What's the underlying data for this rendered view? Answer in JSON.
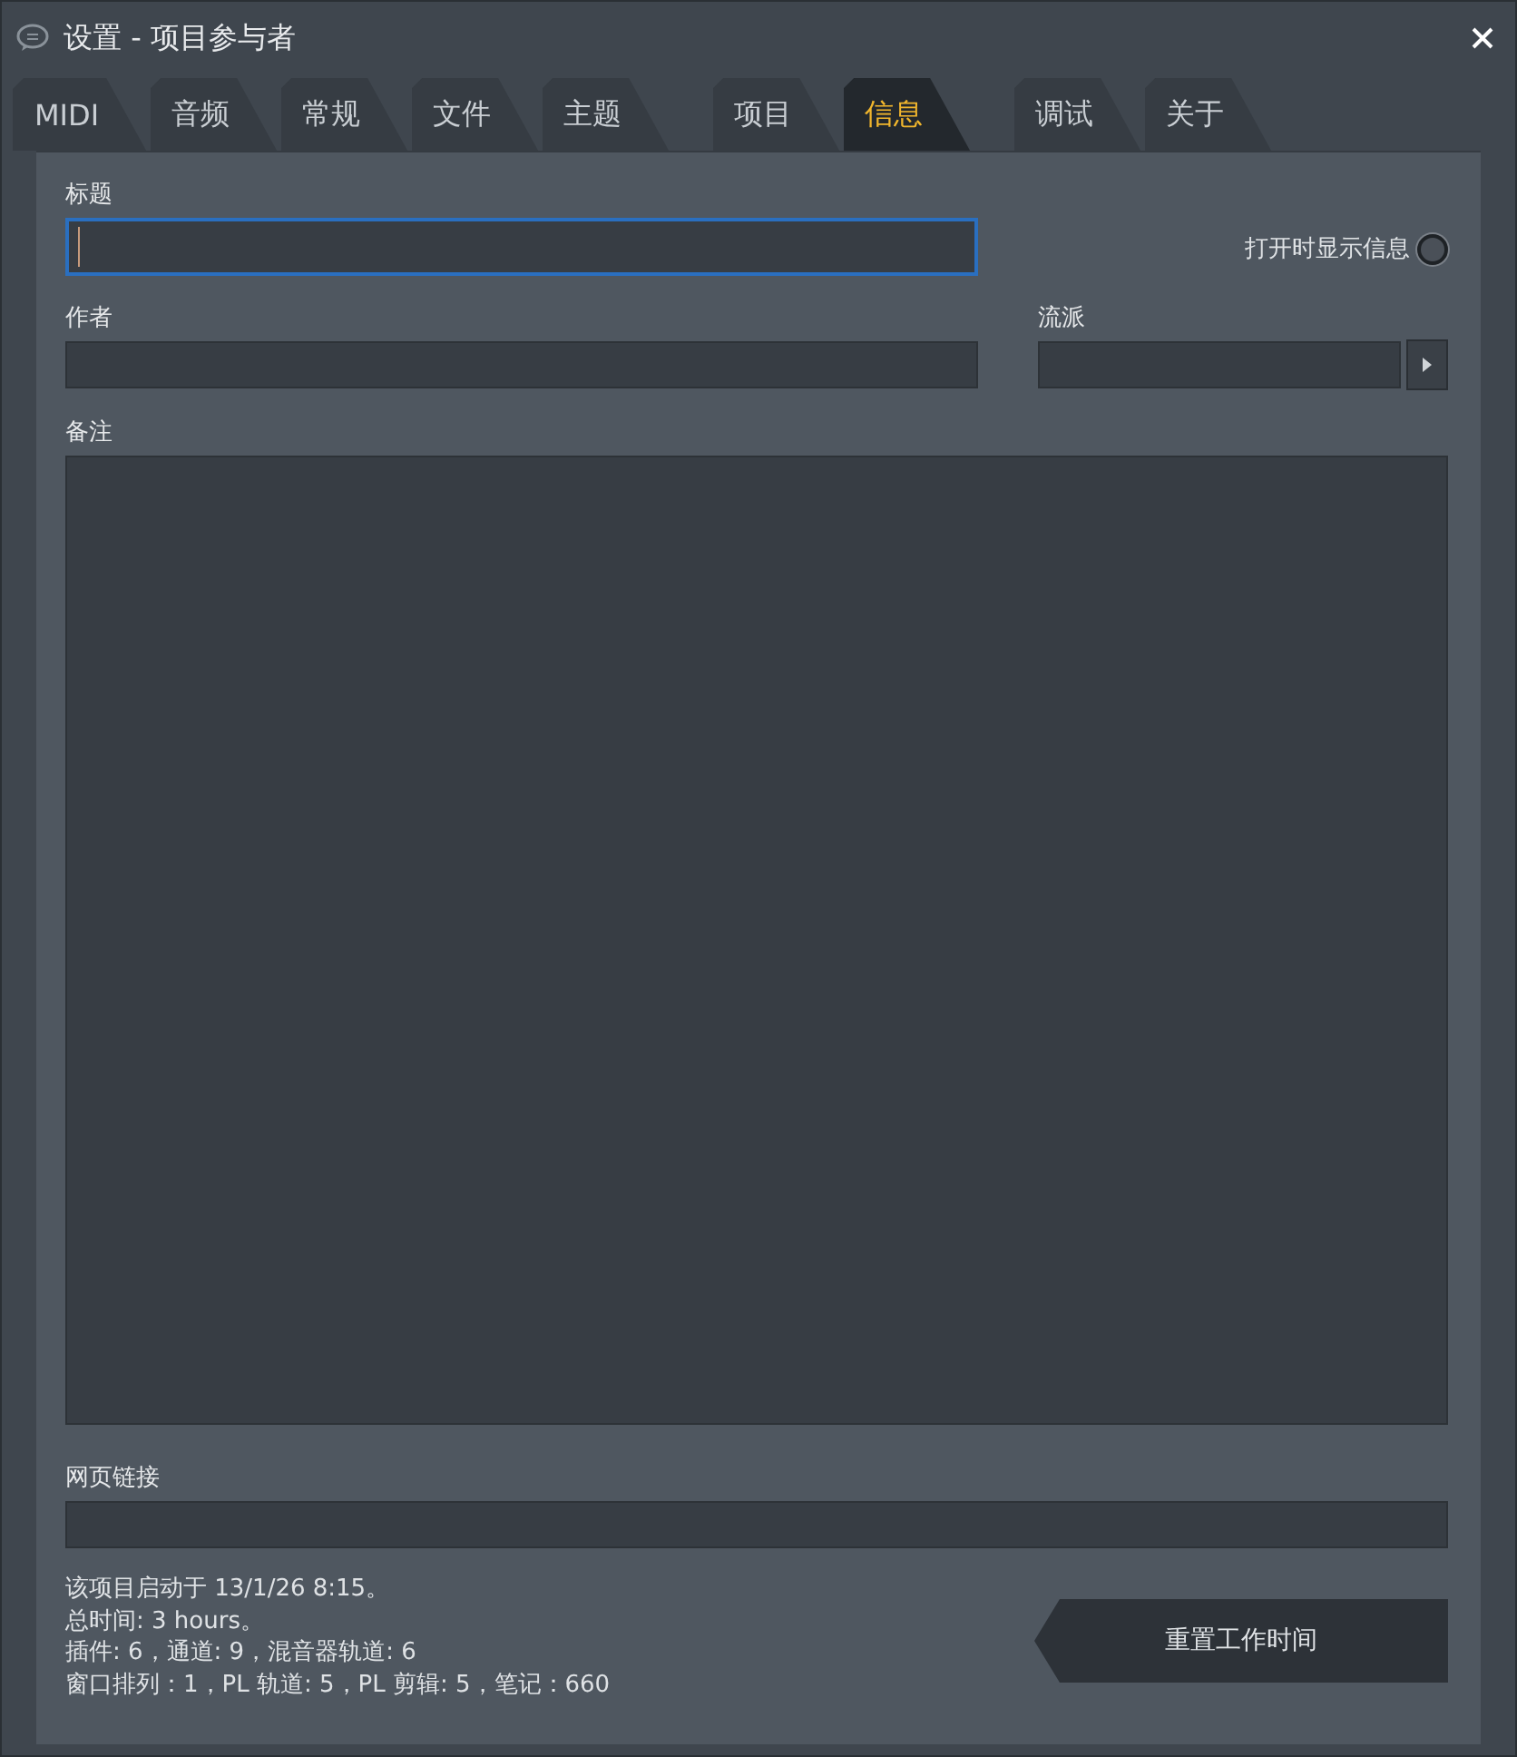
{
  "window": {
    "title": "设置 - 项目参与者"
  },
  "tab_groups": [
    [
      {
        "label": "MIDI",
        "selected": false
      },
      {
        "label": "音频",
        "selected": false
      },
      {
        "label": "常规",
        "selected": false
      },
      {
        "label": "文件",
        "selected": false
      },
      {
        "label": "主题",
        "selected": false
      }
    ],
    [
      {
        "label": "项目",
        "selected": false
      },
      {
        "label": "信息",
        "selected": true
      }
    ],
    [
      {
        "label": "调试",
        "selected": false
      },
      {
        "label": "关于",
        "selected": false
      }
    ]
  ],
  "title_field": {
    "label": "标题",
    "focused": true
  },
  "show_on_open": {
    "label": "打开时显示信息",
    "checked": false
  },
  "author_field": {
    "label": "作者"
  },
  "genre_field": {
    "label": "流派"
  },
  "notes_field": {
    "label": "备注"
  },
  "url_field": {
    "label": "网页链接"
  },
  "info_lines": [
    "该项目启动于 13/1/26 8:15。",
    "总时间:  3 hours。",
    "插件: 6，通道: 9，混音器轨道: 6",
    "窗口排列：1，PL 轨道: 5，PL 剪辑: 5，笔记：660"
  ],
  "reset_button": "重置工作时间"
}
